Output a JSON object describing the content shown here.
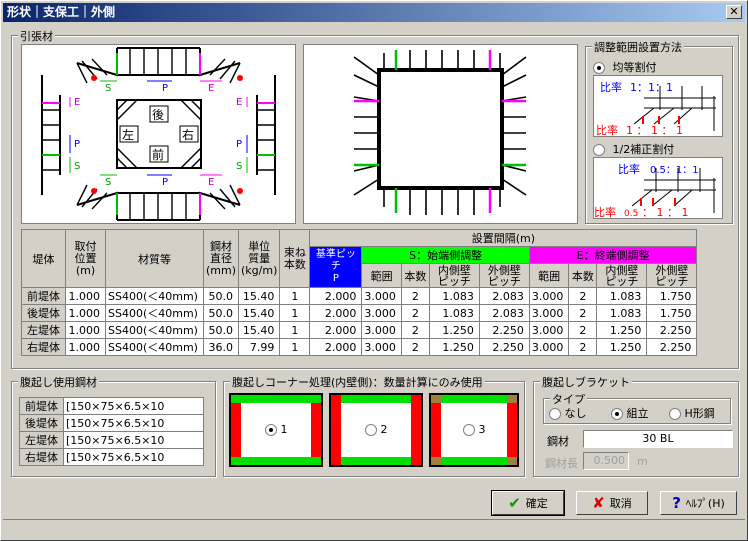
{
  "window": {
    "title": "形状｜支保工｜外側",
    "close_glyph": "✕"
  },
  "tension": {
    "label": "引張材",
    "diagram_labels": {
      "S": "S",
      "P": "P",
      "E": "E",
      "back": "後",
      "front": "前",
      "left": "左",
      "right": "右"
    }
  },
  "adjust": {
    "label": "調整範囲設置方法",
    "option1": "均等割付",
    "option2": "1/2補正割付",
    "ratio_label": "比率",
    "ratio1_top": "1：1：1",
    "ratio1_bot": "1 ： 1 ： 1",
    "ratio2_top": "0.5：1：1",
    "ratio2_bot_a": "0.5",
    "ratio2_bot_b": "： 1 ： 1",
    "selected": 1
  },
  "table": {
    "headers": {
      "wall": "堤体",
      "pos": "取付\n位置\n(m)",
      "material": "材質等",
      "dia": "鋼材\n直径\n(mm)",
      "mass": "単位\n質量\n(kg/m)",
      "count": "束ね\n本数",
      "interval": "設置間隔(m)",
      "pitch": "基準ピッチ\nP",
      "start": "S：始端側調整",
      "end": "E：終端側調整",
      "range": "範囲",
      "num": "本数",
      "inner": "内側壁\nピッチ",
      "outer": "外側壁\nピッチ"
    },
    "rows": [
      {
        "wall": "前堤体",
        "pos": "1.000",
        "material": "SS400(＜40mm)",
        "dia": "50.0",
        "mass": "15.40",
        "count": "1",
        "pitch": "2.000",
        "s_range": "3.000",
        "s_num": "2",
        "s_inner": "1.083",
        "s_outer": "2.083",
        "e_range": "3.000",
        "e_num": "2",
        "e_inner": "1.083",
        "e_outer": "1.750"
      },
      {
        "wall": "後堤体",
        "pos": "1.000",
        "material": "SS400(＜40mm)",
        "dia": "50.0",
        "mass": "15.40",
        "count": "1",
        "pitch": "2.000",
        "s_range": "3.000",
        "s_num": "2",
        "s_inner": "1.083",
        "s_outer": "2.083",
        "e_range": "3.000",
        "e_num": "2",
        "e_inner": "1.083",
        "e_outer": "1.750"
      },
      {
        "wall": "左堤体",
        "pos": "1.000",
        "material": "SS400(＜40mm)",
        "dia": "50.0",
        "mass": "15.40",
        "count": "1",
        "pitch": "2.000",
        "s_range": "3.000",
        "s_num": "2",
        "s_inner": "1.250",
        "s_outer": "2.250",
        "e_range": "3.000",
        "e_num": "2",
        "e_inner": "1.250",
        "e_outer": "2.250"
      },
      {
        "wall": "右堤体",
        "pos": "1.000",
        "material": "SS400(＜40mm)",
        "dia": "36.0",
        "mass": "7.99",
        "count": "1",
        "pitch": "2.000",
        "s_range": "3.000",
        "s_num": "2",
        "s_inner": "1.250",
        "s_outer": "2.250",
        "e_range": "3.000",
        "e_num": "2",
        "e_inner": "1.250",
        "e_outer": "2.250"
      }
    ]
  },
  "wale_steel": {
    "label": "腹起し使用鋼材",
    "rows": [
      {
        "wall": "前堤体",
        "steel": "[150×75×6.5×10"
      },
      {
        "wall": "後堤体",
        "steel": "[150×75×6.5×10"
      },
      {
        "wall": "左堤体",
        "steel": "[150×75×6.5×10"
      },
      {
        "wall": "右堤体",
        "steel": "[150×75×6.5×10"
      }
    ]
  },
  "corner": {
    "label": "腹起しコーナー処理(内壁側)：数量計算にのみ使用",
    "options": [
      "1",
      "2",
      "3"
    ],
    "selected": 0
  },
  "bracket": {
    "label": "腹起しブラケット",
    "type_label": "タイプ",
    "types": [
      "なし",
      "組立",
      "H形鋼"
    ],
    "selected": 1,
    "steel_label": "鋼材",
    "steel_value": "30 BL",
    "length_label": "鋼材長",
    "length_value": "0.500",
    "length_unit": "m"
  },
  "buttons": {
    "ok": "確定",
    "cancel": "取消",
    "help": "ﾍﾙﾌﾟ(H)"
  },
  "colors": {
    "green": "#00ff00",
    "magenta": "#ff00ff",
    "red": "#ff0000",
    "blue": "#0000ff"
  }
}
